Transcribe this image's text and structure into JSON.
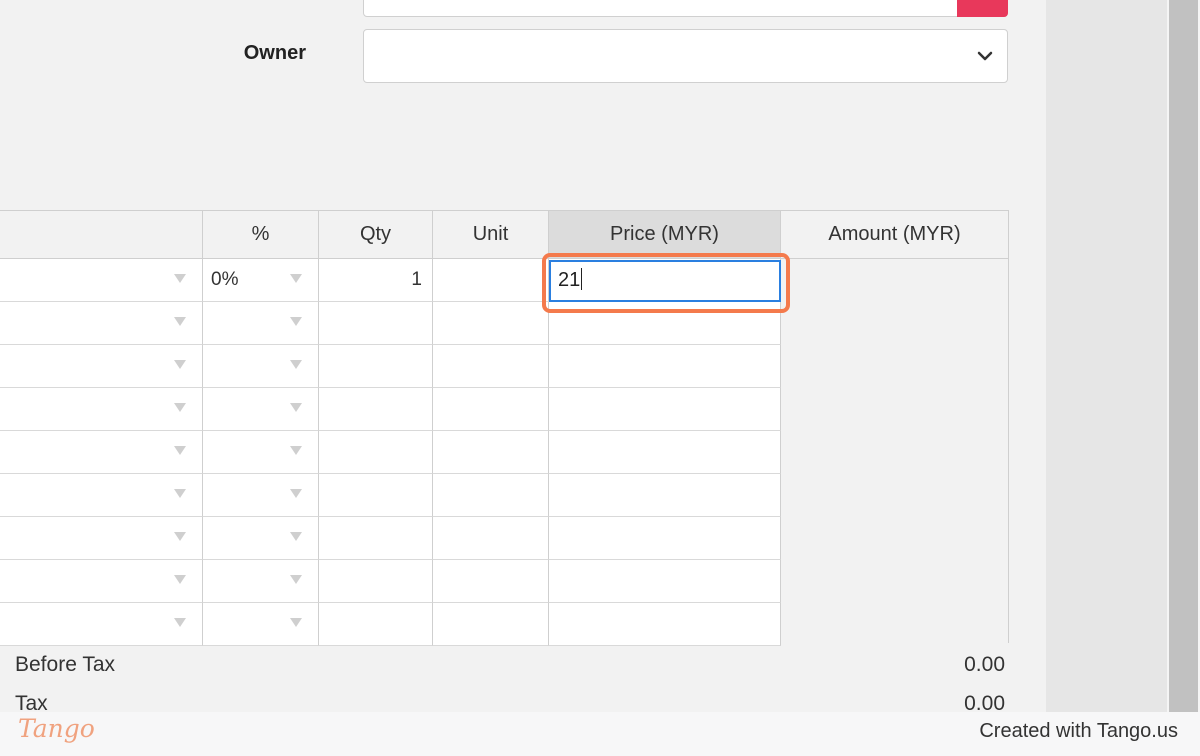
{
  "form": {
    "owner_label": "Owner",
    "owner_value": ""
  },
  "table": {
    "headers": [
      "",
      "%",
      "Qty",
      "Unit",
      "Price (MYR)",
      "Amount (MYR)"
    ],
    "rows": [
      {
        "item": "",
        "discount": "0%",
        "qty": "1",
        "unit": "",
        "price": "21"
      },
      {
        "item": "",
        "discount": "",
        "qty": "",
        "unit": "",
        "price": ""
      },
      {
        "item": "",
        "discount": "",
        "qty": "",
        "unit": "",
        "price": ""
      },
      {
        "item": "",
        "discount": "",
        "qty": "",
        "unit": "",
        "price": ""
      },
      {
        "item": "",
        "discount": "",
        "qty": "",
        "unit": "",
        "price": ""
      },
      {
        "item": "",
        "discount": "",
        "qty": "",
        "unit": "",
        "price": ""
      },
      {
        "item": "",
        "discount": "",
        "qty": "",
        "unit": "",
        "price": ""
      },
      {
        "item": "",
        "discount": "",
        "qty": "",
        "unit": "",
        "price": ""
      },
      {
        "item": "",
        "discount": "",
        "qty": "",
        "unit": "",
        "price": ""
      }
    ]
  },
  "summary": {
    "before_tax_label": "Before Tax",
    "before_tax_value": "0.00",
    "tax_label": "Tax",
    "tax_value": "0.00"
  },
  "footer": {
    "logo_text": "Tango",
    "created_text": "Created with Tango.us"
  },
  "colors": {
    "accent_red": "#e8385b",
    "focus_blue": "#2a7fe0",
    "highlight_orange": "#f47a4c"
  },
  "icons": {
    "owner_select": "chevron-down-icon",
    "dropdown": "dropdown-arrow-icon"
  }
}
